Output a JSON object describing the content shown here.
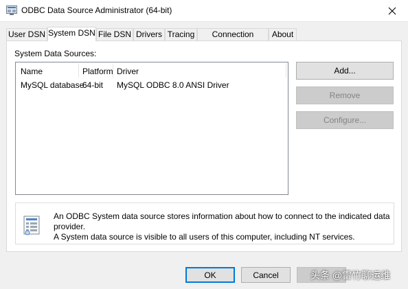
{
  "window": {
    "title": "ODBC Data Source Administrator (64-bit)",
    "app_icon": "odbc-admin-icon",
    "close_icon": "close-icon"
  },
  "tabs": [
    {
      "label": "User DSN"
    },
    {
      "label": "System DSN",
      "active": true
    },
    {
      "label": "File DSN"
    },
    {
      "label": "Drivers"
    },
    {
      "label": "Tracing"
    },
    {
      "label": "Connection Pooling"
    },
    {
      "label": "About"
    }
  ],
  "system_dsn": {
    "section_label": "System Data Sources:",
    "columns": [
      "Name",
      "Platform",
      "Driver"
    ],
    "rows": [
      {
        "name": "MySQL database",
        "platform": "64-bit",
        "driver": "MySQL ODBC 8.0 ANSI Driver"
      }
    ],
    "buttons": {
      "add": "Add...",
      "remove": "Remove",
      "configure": "Configure..."
    },
    "info": {
      "icon": "data-source-info-icon",
      "line1": "An ODBC System data source stores information about how to connect to the indicated data provider.",
      "line2": "A System data source is visible to all users of this computer, including NT services."
    }
  },
  "footer": {
    "ok": "OK",
    "cancel": "Cancel",
    "watermark": "头条 @雷竹聊运维"
  },
  "colors": {
    "accent": "#0078d7",
    "list_border": "#828790"
  }
}
